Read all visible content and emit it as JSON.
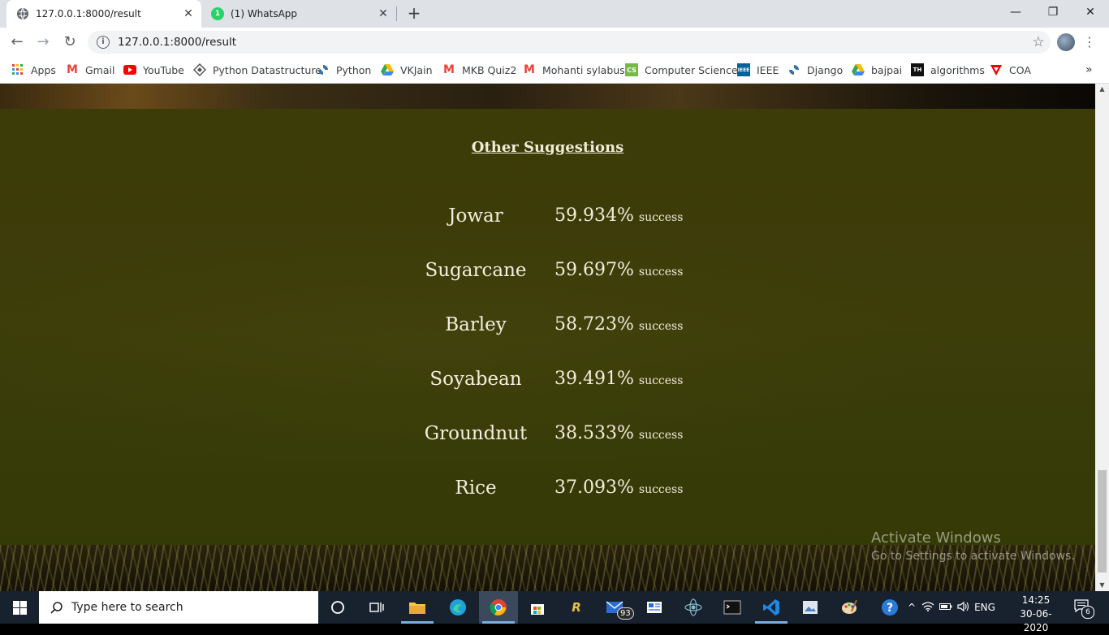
{
  "browser": {
    "tabs": [
      {
        "title": "127.0.0.1:8000/result",
        "active": true
      },
      {
        "title": "(1) WhatsApp",
        "active": false,
        "badge": "1"
      }
    ],
    "url": "127.0.0.1:8000/result",
    "bookmarks": [
      {
        "label": "Apps",
        "icon": "apps-grid-icon"
      },
      {
        "label": "Gmail",
        "icon": "gmail-icon"
      },
      {
        "label": "YouTube",
        "icon": "youtube-icon"
      },
      {
        "label": "Python Datastructure",
        "icon": "python-datastructure-icon"
      },
      {
        "label": "Python",
        "icon": "python-icon"
      },
      {
        "label": "VKJain",
        "icon": "google-drive-icon"
      },
      {
        "label": "MKB Quiz2",
        "icon": "gmail-icon"
      },
      {
        "label": "Mohanti sylabus",
        "icon": "gmail-icon"
      },
      {
        "label": "Computer Science",
        "icon": "computer-science-icon"
      },
      {
        "label": "IEEE",
        "icon": "ieee-icon"
      },
      {
        "label": "Django",
        "icon": "django-icon"
      },
      {
        "label": "bajpai",
        "icon": "google-drive-icon"
      },
      {
        "label": "algorithms",
        "icon": "algorithms-icon"
      },
      {
        "label": "COA",
        "icon": "coa-icon"
      }
    ],
    "more_bookmarks": "»"
  },
  "page": {
    "heading": "Other Suggestions",
    "suffix": "success",
    "suggestions": [
      {
        "crop": "Jowar",
        "percent": "59.934%"
      },
      {
        "crop": "Sugarcane",
        "percent": "59.697%"
      },
      {
        "crop": "Barley",
        "percent": "58.723%"
      },
      {
        "crop": "Soyabean",
        "percent": "39.491%"
      },
      {
        "crop": "Groundnut",
        "percent": "38.533%"
      },
      {
        "crop": "Rice",
        "percent": "37.093%"
      }
    ]
  },
  "watermark": {
    "title": "Activate Windows",
    "subtitle": "Go to Settings to activate Windows."
  },
  "taskbar": {
    "search_placeholder": "Type here to search",
    "mail_badge": "93",
    "language": "ENG",
    "time": "14:25",
    "date": "30-06-2020",
    "notification_count": "6"
  }
}
